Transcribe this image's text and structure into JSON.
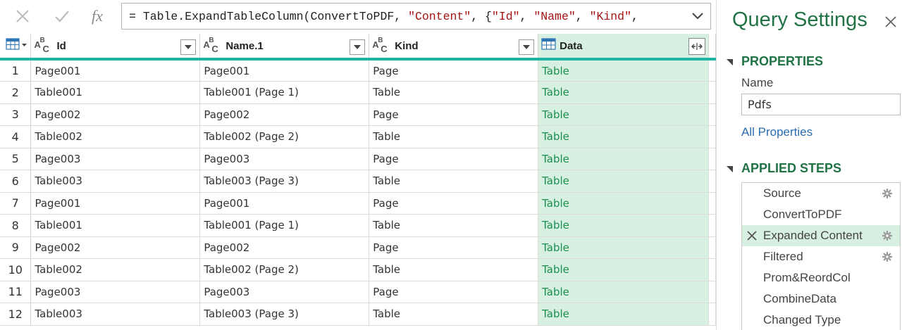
{
  "formula": {
    "parts": [
      {
        "t": "= Table.ExpandTableColumn(ConvertToPDF, ",
        "s": false
      },
      {
        "t": "\"Content\"",
        "s": true
      },
      {
        "t": ", {",
        "s": false
      },
      {
        "t": "\"Id\"",
        "s": true
      },
      {
        "t": ", ",
        "s": false
      },
      {
        "t": "\"Name\"",
        "s": true
      },
      {
        "t": ", ",
        "s": false
      },
      {
        "t": "\"Kind\"",
        "s": true
      },
      {
        "t": ",",
        "s": false
      }
    ]
  },
  "grid": {
    "columns": [
      {
        "label": "Id",
        "type_icon": "text-type-icon"
      },
      {
        "label": "Name.1",
        "type_icon": "text-type-icon"
      },
      {
        "label": "Kind",
        "type_icon": "text-type-icon"
      },
      {
        "label": "Data",
        "type_icon": "table-type-icon"
      }
    ],
    "rows": [
      {
        "n": "1",
        "id": "Page001",
        "name": "Page001",
        "kind": "Page",
        "data": "Table"
      },
      {
        "n": "2",
        "id": "Table001",
        "name": "Table001 (Page 1)",
        "kind": "Table",
        "data": "Table"
      },
      {
        "n": "3",
        "id": "Page002",
        "name": "Page002",
        "kind": "Page",
        "data": "Table"
      },
      {
        "n": "4",
        "id": "Table002",
        "name": "Table002 (Page 2)",
        "kind": "Table",
        "data": "Table"
      },
      {
        "n": "5",
        "id": "Page003",
        "name": "Page003",
        "kind": "Page",
        "data": "Table"
      },
      {
        "n": "6",
        "id": "Table003",
        "name": "Table003 (Page 3)",
        "kind": "Table",
        "data": "Table"
      },
      {
        "n": "7",
        "id": "Page001",
        "name": "Page001",
        "kind": "Page",
        "data": "Table"
      },
      {
        "n": "8",
        "id": "Table001",
        "name": "Table001 (Page 1)",
        "kind": "Table",
        "data": "Table"
      },
      {
        "n": "9",
        "id": "Page002",
        "name": "Page002",
        "kind": "Page",
        "data": "Table"
      },
      {
        "n": "10",
        "id": "Table002",
        "name": "Table002 (Page 2)",
        "kind": "Table",
        "data": "Table"
      },
      {
        "n": "11",
        "id": "Page003",
        "name": "Page003",
        "kind": "Page",
        "data": "Table"
      },
      {
        "n": "12",
        "id": "Table003",
        "name": "Table003 (Page 3)",
        "kind": "Table",
        "data": "Table"
      }
    ]
  },
  "settings": {
    "title": "Query Settings",
    "properties_header": "PROPERTIES",
    "name_label": "Name",
    "name_value": "Pdfs",
    "all_properties": "All Properties",
    "steps_header": "APPLIED STEPS",
    "steps": [
      {
        "label": "Source",
        "gear": true,
        "selected": false
      },
      {
        "label": "ConvertToPDF",
        "gear": false,
        "selected": false
      },
      {
        "label": "Expanded Content",
        "gear": true,
        "selected": true
      },
      {
        "label": "Filtered",
        "gear": true,
        "selected": false
      },
      {
        "label": "Prom&ReordCol",
        "gear": false,
        "selected": false
      },
      {
        "label": "CombineData",
        "gear": false,
        "selected": false
      },
      {
        "label": "Changed Type",
        "gear": false,
        "selected": false
      }
    ]
  },
  "colors": {
    "accent": "#217346",
    "selected_bg": "#d8f0e2",
    "table_link": "#1b8f4e",
    "header_rule": "#1fb5a3",
    "string_literal": "#a31515"
  }
}
